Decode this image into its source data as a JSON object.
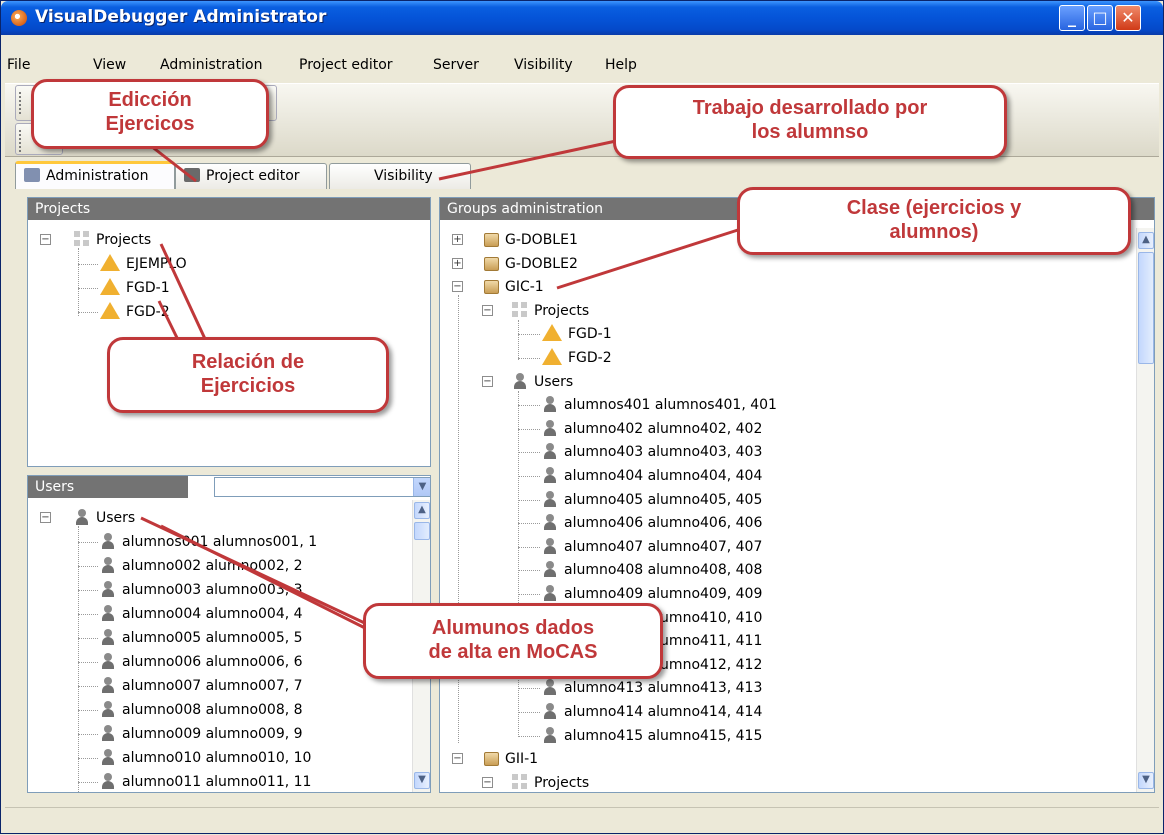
{
  "window": {
    "title": "VisualDebugger Administrator"
  },
  "menu": [
    "File",
    "View",
    "Administration",
    "Project editor",
    "Server",
    "Visibility",
    "Help"
  ],
  "tabs": [
    "Administration",
    "Project editor",
    "Visibility"
  ],
  "projects_panel": {
    "header": "Projects",
    "root": "Projects",
    "items": [
      "EJEMPLO",
      "FGD-1",
      "FGD-2"
    ]
  },
  "users_panel": {
    "header": "Users",
    "root": "Users",
    "items": [
      "alumnos001 alumnos001, 1",
      "alumno002 alumno002, 2",
      "alumno003 alumno003, 3",
      "alumno004 alumno004, 4",
      "alumno005 alumno005, 5",
      "alumno006 alumno006, 6",
      "alumno007 alumno007, 7",
      "alumno008 alumno008, 8",
      "alumno009 alumno009, 9",
      "alumno010 alumno010, 10",
      "alumno011 alumno011, 11"
    ]
  },
  "groups_panel": {
    "header": "Groups administration",
    "groups": [
      "G-DOBLE1",
      "G-DOBLE2",
      "GIC-1",
      "GII-1"
    ],
    "gic_projects_label": "Projects",
    "gic_projects": [
      "FGD-1",
      "FGD-2"
    ],
    "gic_users_label": "Users",
    "gic_users": [
      "alumnos401 alumnos401, 401",
      "alumno402 alumno402, 402",
      "alumno403 alumno403, 403",
      "alumno404 alumno404, 404",
      "alumno405 alumno405, 405",
      "alumno406 alumno406, 406",
      "alumno407 alumno407, 407",
      "alumno408 alumno408, 408",
      "alumno409 alumno409, 409",
      "alumno410 alumno410, 410",
      "alumno411 alumno411, 411",
      "alumno412 alumno412, 412",
      "alumno413 alumno413, 413",
      "alumno414 alumno414, 414",
      "alumno415 alumno415, 415"
    ],
    "gii_projects_label": "Projects"
  },
  "callouts": {
    "edicion": [
      "Edicción",
      "Ejercicos"
    ],
    "trabajo": [
      "Trabajo desarrollado por",
      "los alumnso"
    ],
    "clase": [
      "Clase (ejercicios y",
      "alumnos)"
    ],
    "relacion": [
      "Relación de",
      "Ejercicios"
    ],
    "alumnos": [
      "Alumunos dados",
      "de alta en MoCAS"
    ]
  },
  "colors": {
    "titlebar": "#0554d8",
    "panel_header": "#737373",
    "callout": "#c0383a"
  }
}
